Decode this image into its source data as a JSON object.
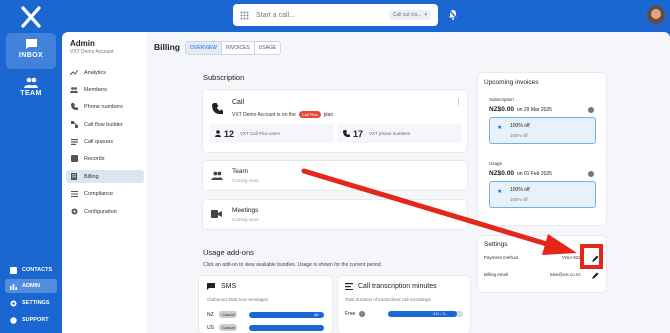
{
  "rail": {
    "inbox": "INBOX",
    "team": "TEAM",
    "contacts": "CONTACTS",
    "admin": "ADMIN",
    "settings": "SETTINGS",
    "support": "SUPPORT"
  },
  "search": {
    "placeholder": "Start a call...",
    "call_out": "Call out via..."
  },
  "sidebar": {
    "title": "Admin",
    "subtitle": "VXT Demo Account",
    "items": [
      "Analytics",
      "Members",
      "Phone numbers",
      "Call flow builder",
      "Call queues",
      "Records",
      "Billing",
      "Compliance",
      "Configuration"
    ]
  },
  "page": {
    "title": "Billing",
    "tabs": [
      "OVERVIEW",
      "INVOICES",
      "USAGE"
    ]
  },
  "subscription": {
    "heading": "Subscription",
    "call_title": "Call",
    "call_desc_pre": "VXT Demo Account is on the",
    "plan_badge": "Call Plus",
    "call_desc_post": "plan",
    "users_count": "12",
    "users_label": "VXT Call Plus users",
    "numbers_count": "17",
    "numbers_label": "VXT phone numbers",
    "team_title": "Team",
    "team_sub": "Coming soon",
    "meetings_title": "Meetings",
    "meetings_sub": "Coming soon"
  },
  "addons": {
    "heading": "Usage add-ons",
    "desc": "Click an add-on to view available bundles. Usage is shown for the current period.",
    "sms_title": "SMS",
    "sms_desc": "Outbound SMS text messages",
    "sms_row1": "NZ",
    "sms_row1_badge": "Casual",
    "sms_row1_value": "46",
    "sms_row2": "US",
    "sms_row2_badge": "Casual",
    "trans_title": "Call transcription minutes",
    "trans_desc": "Total duration of transcribed call recordings",
    "trans_row": "Free",
    "trans_value": "311 / 3..."
  },
  "invoices": {
    "heading": "Upcoming invoices",
    "sub_label": "Subscription",
    "sub_amount": "NZ$0.00",
    "sub_date": "on 29 Mar 2025",
    "sub_discount": "100% off",
    "sub_discount2": "100% off",
    "usage_label": "Usage",
    "usage_amount": "NZ$0.00",
    "usage_date": "on 01 Feb 2025",
    "usage_discount": "100% off",
    "usage_discount2": "100% off"
  },
  "settings": {
    "heading": "Settings",
    "payment_label": "Payment method",
    "payment_value": "VISA  9226",
    "email_label": "Billing email",
    "email_value": "luke@vxt.co.nz"
  },
  "colors": {
    "brand": "#1a67d2",
    "annotation": "#e5261b",
    "badge": "#e24a3b"
  }
}
